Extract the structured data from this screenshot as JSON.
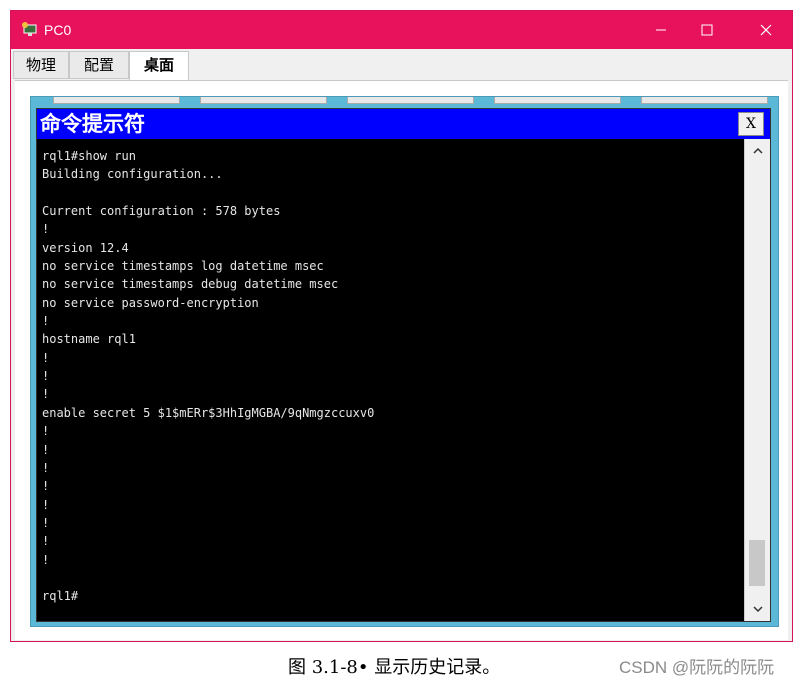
{
  "window": {
    "title": "PC0",
    "icons": {
      "app": "pc-icon",
      "minimize": "minimize-icon",
      "maximize": "maximize-icon",
      "close": "close-icon"
    },
    "titlebar_color": "#e8125c"
  },
  "tabs": [
    {
      "label": "物理",
      "active": false
    },
    {
      "label": "配置",
      "active": false
    },
    {
      "label": "桌面",
      "active": true
    }
  ],
  "command_prompt": {
    "title": "命令提示符",
    "close_label": "X",
    "header_color": "#0000ff",
    "lines": [
      "rql1#show run",
      "Building configuration...",
      "",
      "Current configuration : 578 bytes",
      "!",
      "version 12.4",
      "no service timestamps log datetime msec",
      "no service timestamps debug datetime msec",
      "no service password-encryption",
      "!",
      "hostname rql1",
      "!",
      "!",
      "!",
      "enable secret 5 $1$mERr$3HhIgMGBA/9qNmgzccuxv0",
      "!",
      "!",
      "!",
      "!",
      "!",
      "!",
      "!",
      "!",
      "",
      "rql1#"
    ]
  },
  "caption": "图 3.1-8• 显示历史记录。",
  "watermark": "CSDN @阮阮的阮阮"
}
